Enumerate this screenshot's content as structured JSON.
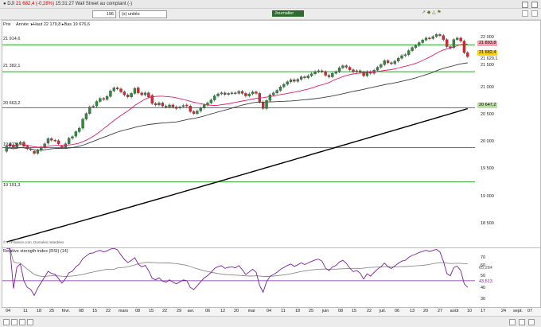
{
  "window": {
    "title_prefix": "● DJI",
    "price_change": "21 682,4 (-0,28%)",
    "title_suffix": "15:31:27 Wall Street au comptant (-)"
  },
  "toolbar": {
    "quantity": "196",
    "unit_select": "(x) unités",
    "period": "Journalier",
    "icons": "↗ ◆ △ ⚑"
  },
  "price_panel": {
    "header": "Prix",
    "stats": "Année :▸Haut 22 179,8 ▸Bas 19 676,6",
    "levels": [
      "21 914,6",
      "21 382,1",
      "20 663,2",
      "19 873",
      "19 191,3"
    ],
    "y_ticks": [
      "22 000",
      "21 500",
      "21 000",
      "20 500",
      "20 000",
      "19 500",
      "19 000",
      "18 500"
    ],
    "badges": {
      "upper": "21 893,8",
      "price": "21 682,4",
      "ma_short": "21 629,1",
      "ma_long": "20 647,2",
      "upper_color": "#ff9fb0",
      "price_color": "#ffd200",
      "ma_long_color": "#bde0a8"
    },
    "footer": "© IT-Finance.com. Données retardées",
    "ma_short_color": "#e4196b",
    "ma_mid_color": "#3c3c3c",
    "ma_long_color": "#000000",
    "level_color": "#2aa52a"
  },
  "rsi_panel": {
    "header": "Relative strength index (RSI) (14)",
    "y_ticks": [
      "70",
      "60",
      "50",
      "40",
      "30"
    ],
    "badges": [
      "65,284",
      "43,513"
    ],
    "rsi_color": "#7a1f9e",
    "signal_color": "#8a8a8a"
  },
  "x_axis": {
    "labels": [
      "04",
      "11",
      "18",
      "25",
      "févr.",
      "08",
      "15",
      "22",
      "mars",
      "08",
      "15",
      "22",
      "29",
      "avr.",
      "06",
      "12",
      "20",
      "mai",
      "04",
      "11",
      "18",
      "25",
      "juin",
      "08",
      "15",
      "22",
      "juil.",
      "06",
      "13",
      "20",
      "27",
      "août",
      "10",
      "17",
      "24",
      "sept.",
      "07"
    ]
  },
  "chart_data": {
    "type": "candlestick",
    "values": [
      {
        "o": 19800,
        "c": 19900
      },
      {
        "o": 19900,
        "c": 19950
      },
      {
        "o": 19920,
        "c": 19880
      },
      {
        "o": 19880,
        "c": 19960
      },
      {
        "o": 19950,
        "c": 19980
      },
      {
        "o": 19980,
        "c": 19900
      },
      {
        "o": 19900,
        "c": 19850
      },
      {
        "o": 19850,
        "c": 19830
      },
      {
        "o": 19800,
        "c": 19760
      },
      {
        "o": 19760,
        "c": 19820
      },
      {
        "o": 19820,
        "c": 19880
      },
      {
        "o": 19880,
        "c": 19950
      },
      {
        "o": 19960,
        "c": 20050
      },
      {
        "o": 20050,
        "c": 20020
      },
      {
        "o": 20020,
        "c": 20010
      },
      {
        "o": 20010,
        "c": 19950
      },
      {
        "o": 19900,
        "c": 19880
      },
      {
        "o": 19880,
        "c": 19950
      },
      {
        "o": 19950,
        "c": 20060
      },
      {
        "o": 20060,
        "c": 20090
      },
      {
        "o": 20100,
        "c": 20190
      },
      {
        "o": 20190,
        "c": 20260
      },
      {
        "o": 20260,
        "c": 20440
      },
      {
        "o": 20440,
        "c": 20550
      },
      {
        "o": 20550,
        "c": 20680
      },
      {
        "o": 20690,
        "c": 20700
      },
      {
        "o": 20700,
        "c": 20790
      },
      {
        "o": 20790,
        "c": 20850
      },
      {
        "o": 20850,
        "c": 20830
      },
      {
        "o": 20830,
        "c": 20890
      },
      {
        "o": 20890,
        "c": 21000
      },
      {
        "o": 21000,
        "c": 21060
      },
      {
        "o": 21060,
        "c": 21040
      },
      {
        "o": 21040,
        "c": 20980
      },
      {
        "o": 20980,
        "c": 20920
      },
      {
        "o": 20920,
        "c": 20880
      },
      {
        "o": 20880,
        "c": 20950
      },
      {
        "o": 20950,
        "c": 21050
      },
      {
        "o": 21060,
        "c": 20960
      },
      {
        "o": 20960,
        "c": 20920
      },
      {
        "o": 20920,
        "c": 20960
      },
      {
        "o": 20960,
        "c": 20880
      },
      {
        "o": 20910,
        "c": 20750
      },
      {
        "o": 20750,
        "c": 20720
      },
      {
        "o": 20720,
        "c": 20760
      },
      {
        "o": 20760,
        "c": 20700
      },
      {
        "o": 20700,
        "c": 20680
      },
      {
        "o": 20680,
        "c": 20720
      },
      {
        "o": 20720,
        "c": 20680
      },
      {
        "o": 20680,
        "c": 20650
      },
      {
        "o": 20660,
        "c": 20680
      },
      {
        "o": 20690,
        "c": 20710
      },
      {
        "o": 20720,
        "c": 20700
      },
      {
        "o": 20700,
        "c": 20590
      },
      {
        "o": 20590,
        "c": 20550
      },
      {
        "o": 20550,
        "c": 20600
      },
      {
        "o": 20600,
        "c": 20660
      },
      {
        "o": 20660,
        "c": 20720
      },
      {
        "o": 20720,
        "c": 20760
      },
      {
        "o": 20760,
        "c": 20820
      },
      {
        "o": 20820,
        "c": 20900
      },
      {
        "o": 20900,
        "c": 20940
      },
      {
        "o": 20940,
        "c": 20960
      },
      {
        "o": 20960,
        "c": 20930
      },
      {
        "o": 20930,
        "c": 20950
      },
      {
        "o": 20950,
        "c": 20960
      },
      {
        "o": 20960,
        "c": 20950
      },
      {
        "o": 20950,
        "c": 20990
      },
      {
        "o": 20990,
        "c": 20950
      },
      {
        "o": 20950,
        "c": 20900
      },
      {
        "o": 20900,
        "c": 20940
      },
      {
        "o": 20940,
        "c": 20980
      },
      {
        "o": 20980,
        "c": 20950
      },
      {
        "o": 20950,
        "c": 20780
      },
      {
        "o": 20780,
        "c": 20650
      },
      {
        "o": 20650,
        "c": 20810
      },
      {
        "o": 20810,
        "c": 20920
      },
      {
        "o": 20920,
        "c": 20960
      },
      {
        "o": 20960,
        "c": 21010
      },
      {
        "o": 21010,
        "c": 21080
      },
      {
        "o": 21080,
        "c": 21130
      },
      {
        "o": 21130,
        "c": 21180
      },
      {
        "o": 21180,
        "c": 21220
      },
      {
        "o": 21220,
        "c": 21190
      },
      {
        "o": 21190,
        "c": 21230
      },
      {
        "o": 21230,
        "c": 21280
      },
      {
        "o": 21280,
        "c": 21260
      },
      {
        "o": 21260,
        "c": 21300
      },
      {
        "o": 21300,
        "c": 21340
      },
      {
        "o": 21340,
        "c": 21380
      },
      {
        "o": 21380,
        "c": 21400
      },
      {
        "o": 21400,
        "c": 21380
      },
      {
        "o": 21380,
        "c": 21310
      },
      {
        "o": 21310,
        "c": 21280
      },
      {
        "o": 21280,
        "c": 21350
      },
      {
        "o": 21350,
        "c": 21380
      },
      {
        "o": 21380,
        "c": 21460
      },
      {
        "o": 21460,
        "c": 21500
      },
      {
        "o": 21500,
        "c": 21470
      },
      {
        "o": 21470,
        "c": 21420
      },
      {
        "o": 21420,
        "c": 21380
      },
      {
        "o": 21380,
        "c": 21400
      },
      {
        "o": 21400,
        "c": 21370
      },
      {
        "o": 21370,
        "c": 21300
      },
      {
        "o": 21300,
        "c": 21380
      },
      {
        "o": 21380,
        "c": 21350
      },
      {
        "o": 21350,
        "c": 21410
      },
      {
        "o": 21410,
        "c": 21470
      },
      {
        "o": 21470,
        "c": 21520
      },
      {
        "o": 21520,
        "c": 21600
      },
      {
        "o": 21600,
        "c": 21560
      },
      {
        "o": 21560,
        "c": 21540
      },
      {
        "o": 21540,
        "c": 21590
      },
      {
        "o": 21590,
        "c": 21650
      },
      {
        "o": 21650,
        "c": 21700
      },
      {
        "o": 21700,
        "c": 21720
      },
      {
        "o": 21720,
        "c": 21800
      },
      {
        "o": 21800,
        "c": 21860
      },
      {
        "o": 21860,
        "c": 21900
      },
      {
        "o": 21900,
        "c": 21960
      },
      {
        "o": 21960,
        "c": 22010
      },
      {
        "o": 22010,
        "c": 22050
      },
      {
        "o": 22050,
        "c": 22040
      },
      {
        "o": 22040,
        "c": 22080
      },
      {
        "o": 22080,
        "c": 22120
      },
      {
        "o": 22120,
        "c": 22100
      },
      {
        "o": 22100,
        "c": 22020
      },
      {
        "o": 22020,
        "c": 21880
      },
      {
        "o": 21880,
        "c": 21850
      },
      {
        "o": 21860,
        "c": 22020
      },
      {
        "o": 22020,
        "c": 22050
      },
      {
        "o": 22050,
        "c": 21990
      },
      {
        "o": 21990,
        "c": 21760
      },
      {
        "o": 21760,
        "c": 21682
      }
    ],
    "ylim": [
      18000,
      22300
    ]
  }
}
